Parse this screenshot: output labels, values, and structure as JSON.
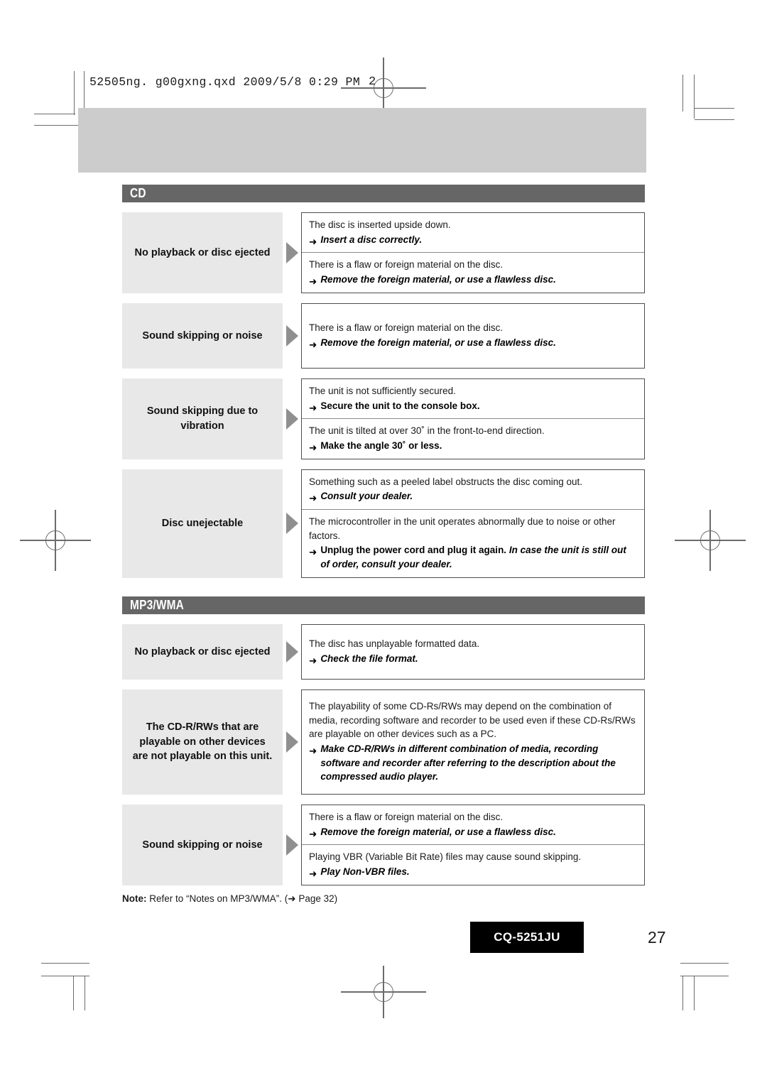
{
  "header": {
    "slug": "52505ng. g00gxng.qxd  2009/5/8  0:29 PM",
    "slug_number": "2"
  },
  "sections": [
    {
      "id": "cd",
      "title": "CD",
      "rows": [
        {
          "label": "No playback or disc ejected",
          "causes": [
            {
              "cause": "The disc is inserted upside down.",
              "arrow": "➜",
              "remedy_style": "italic",
              "remedy": "Insert a disc correctly."
            },
            {
              "cause": "There is a flaw or foreign material on the disc.",
              "arrow": "➜",
              "remedy_style": "italic",
              "remedy": "Remove the foreign material, or use a flawless disc."
            }
          ]
        },
        {
          "label": "Sound skipping or noise",
          "causes": [
            {
              "cause": "There is a flaw or foreign material on the disc.",
              "arrow": "➜",
              "remedy_style": "italic",
              "remedy": "Remove the foreign material, or use a flawless disc."
            }
          ]
        },
        {
          "label": "Sound skipping due to vibration",
          "causes": [
            {
              "cause": "The unit is not sufficiently secured.",
              "arrow": "➜",
              "remedy_style": "roman",
              "remedy": "Secure the unit to the console box."
            },
            {
              "cause": "The unit is tilted at over 30˚ in the front-to-end direction.",
              "arrow": "➜",
              "remedy_style": "roman",
              "remedy": "Make the angle 30˚ or less."
            }
          ]
        },
        {
          "label": "Disc unejectable",
          "causes": [
            {
              "cause": "Something such as a peeled label obstructs the disc coming out.",
              "arrow": "➜",
              "remedy_style": "italic",
              "remedy": "Consult your dealer."
            },
            {
              "cause": "The microcontroller in the unit operates abnormally due to noise or other factors.",
              "arrow": "➜",
              "remedy_style": "mixed",
              "remedy_roman": "Unplug the power cord and plug it again.",
              "remedy_italic": "In case the unit is still out of order, consult your dealer."
            }
          ]
        }
      ]
    },
    {
      "id": "mp3wma",
      "title": "MP3/WMA",
      "rows": [
        {
          "label": "No playback or disc ejected",
          "causes": [
            {
              "cause": "The disc has unplayable formatted data.",
              "arrow": "➜",
              "remedy_style": "italic",
              "remedy": "Check the file format."
            }
          ]
        },
        {
          "label": "The CD-R/RWs that are playable on other devices are not playable on this unit.",
          "causes": [
            {
              "cause": "The playability of some CD-Rs/RWs may depend on the combination of media, recording software and recorder to be used even if these CD-Rs/RWs are playable on other devices such as a PC.",
              "arrow": "➜",
              "remedy_style": "italic",
              "remedy": "Make CD-R/RWs in different combination of media, recording software and recorder after referring to the description about the compressed audio player."
            }
          ]
        },
        {
          "label": "Sound skipping or noise",
          "causes": [
            {
              "cause": "There is a flaw or foreign material on the disc.",
              "arrow": "➜",
              "remedy_style": "italic",
              "remedy": "Remove the foreign material, or use a flawless disc."
            },
            {
              "cause": "Playing VBR (Variable Bit Rate) files may cause sound skipping.",
              "arrow": "➜",
              "remedy_style": "italic",
              "remedy": "Play Non-VBR files."
            }
          ]
        }
      ]
    }
  ],
  "note": {
    "prefix": "Note:",
    "text": " Refer to “Notes on MP3/WMA”. (",
    "arrow": "➜",
    "reference": " Page 32)"
  },
  "footer": {
    "model": "CQ-5251JU",
    "page_number": "27"
  },
  "colors": {
    "section_bar": "#666666",
    "label_bg": "#e8e8e8",
    "top_banner": "#cccccc",
    "box_border": "#4d4d4d",
    "triangle": "#8f8f8f",
    "badge_bg": "#000000"
  }
}
